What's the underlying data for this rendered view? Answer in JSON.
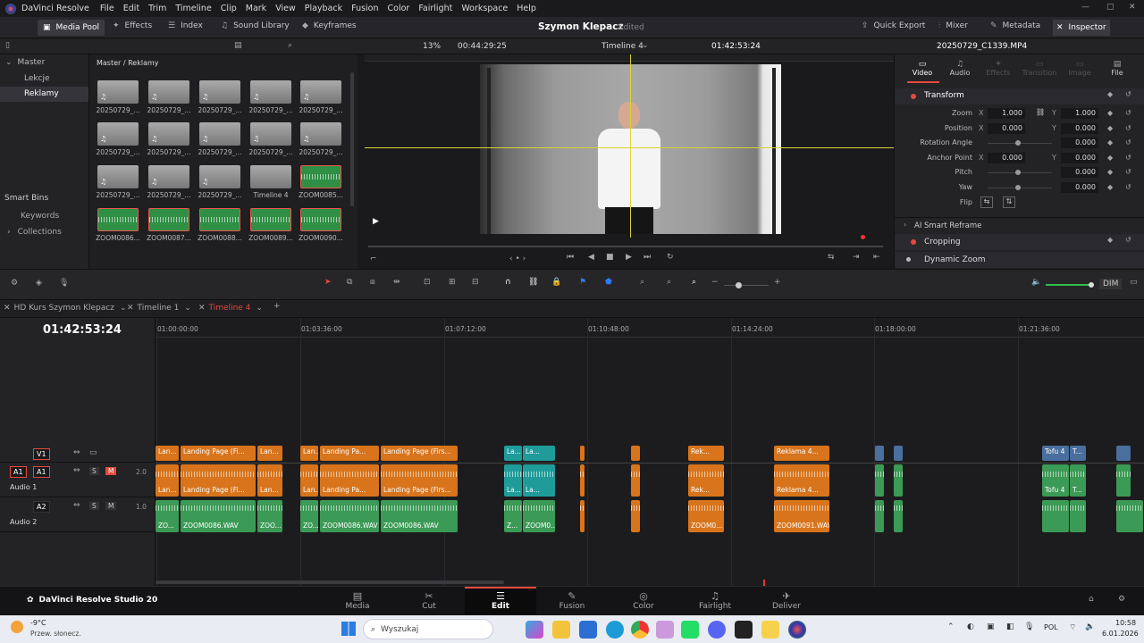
{
  "app": {
    "title": "DaVinci Resolve",
    "project": "Szymon Klepacz",
    "status": "Edited"
  },
  "menu": [
    "File",
    "Edit",
    "Trim",
    "Timeline",
    "Clip",
    "Mark",
    "View",
    "Playback",
    "Fusion",
    "Color",
    "Fairlight",
    "Workspace",
    "Help"
  ],
  "toolbar": {
    "media_pool": "Media Pool",
    "effects": "Effects",
    "index": "Index",
    "sound_library": "Sound Library",
    "keyframes": "Keyframes",
    "quick_export": "Quick Export",
    "mixer": "Mixer",
    "metadata": "Metadata",
    "inspector": "Inspector"
  },
  "viewer_bar": {
    "zoom": "13%",
    "source_tc": "00:44:29:25",
    "timeline_name": "Timeline 4",
    "record_tc": "01:42:53:24",
    "clip_name": "20250729_C1339.MP4"
  },
  "bins": {
    "master": "Master",
    "items": [
      "Lekcje",
      "Reklamy"
    ],
    "smart_bins": "Smart Bins",
    "smart_items": [
      "Keywords",
      "Collections"
    ]
  },
  "pool": {
    "path": "Master / Reklamy",
    "thumbs": [
      "20250729_...",
      "20250729_...",
      "20250729_...",
      "20250729_...",
      "20250729_...",
      "20250729_...",
      "20250729_...",
      "20250729_...",
      "20250729_...",
      "20250729_...",
      "20250729_...",
      "20250729_...",
      "20250729_...",
      "Timeline 4",
      "ZOOM0085...",
      "ZOOM0086...",
      "ZOOM0087...",
      "ZOOM0088...",
      "ZOOM0089...",
      "ZOOM0090..."
    ]
  },
  "inspector": {
    "tabs": [
      "Video",
      "Audio",
      "Effects",
      "Transition",
      "Image",
      "File"
    ],
    "transform": "Transform",
    "rows": [
      {
        "label": "Zoom",
        "axis1": "X",
        "v1": "1.000",
        "axis2": "Y",
        "v2": "1.000"
      },
      {
        "label": "Position",
        "axis1": "X",
        "v1": "0.000",
        "axis2": "Y",
        "v2": "0.000"
      },
      {
        "label": "Rotation Angle",
        "v2": "0.000"
      },
      {
        "label": "Anchor Point",
        "axis1": "X",
        "v1": "0.000",
        "axis2": "Y",
        "v2": "0.000"
      },
      {
        "label": "Pitch",
        "v2": "0.000"
      },
      {
        "label": "Yaw",
        "v2": "0.000"
      },
      {
        "label": "Flip"
      }
    ],
    "ai_reframe": "AI Smart Reframe",
    "cropping": "Cropping",
    "dynamic_zoom": "Dynamic Zoom"
  },
  "timeline": {
    "tabs": [
      "HD Kurs Szymon Klepacz",
      "Timeline 1",
      "Timeline 4"
    ],
    "timecode": "01:42:53:24",
    "ruler": [
      "01:00:00:00",
      "01:03:36:00",
      "01:07:12:00",
      "01:10:48:00",
      "01:14:24:00",
      "01:18:00:00",
      "01:21:36:00"
    ],
    "tracks": {
      "v1": "V1",
      "a1": "A1",
      "audio1": "Audio 1",
      "a1vol": "2.0",
      "a2": "A2",
      "audio2": "Audio 2",
      "a2vol": "1.0",
      "s": "S",
      "m": "M"
    },
    "clips": {
      "lan": "Lan...",
      "landing_fi": "Landing Page (Fi...",
      "landing_firs": "Landing Page (Firs...",
      "landing_pa": "Landing Pa...",
      "la": "La...",
      "rek": "Rek...",
      "reklama4": "Reklama 4...",
      "tofu4": "Tofu 4",
      "t": "T...",
      "zo": "ZO...",
      "zoom0086": "ZOOM0086.WAV",
      "zoo": "ZOO...",
      "z": "Z...",
      "zoom0": "ZOOM0...",
      "zoom0091": "ZOOM0091.WAV"
    }
  },
  "audio_meter": {
    "dim": "DIM"
  },
  "pages": [
    "Media",
    "Cut",
    "Edit",
    "Fusion",
    "Color",
    "Fairlight",
    "Deliver"
  ],
  "active_page": "Edit",
  "brand": "DaVinci Resolve Studio 20",
  "taskbar": {
    "temp": "-9°C",
    "weather": "Przew. słonecz.",
    "search": "Wyszukaj",
    "lang": "POL",
    "time": "10:58",
    "date": "6.01.2026"
  }
}
